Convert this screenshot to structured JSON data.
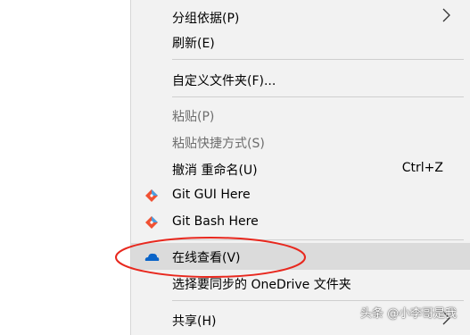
{
  "menu": {
    "items": [
      {
        "label": "分组依据(P)",
        "has_submenu": true
      },
      {
        "label": "刷新(E)"
      },
      {
        "label": "自定义文件夹(F)..."
      },
      {
        "label": "粘贴(P)",
        "disabled": true
      },
      {
        "label": "粘贴快捷方式(S)",
        "disabled": true
      },
      {
        "label": "撤消 重命名(U)",
        "shortcut": "Ctrl+Z"
      },
      {
        "label": "Git GUI Here",
        "icon": "git-icon"
      },
      {
        "label": "Git Bash Here",
        "icon": "git-icon"
      },
      {
        "label": "在线查看(V)",
        "icon": "onedrive-cloud-icon",
        "highlighted": true
      },
      {
        "label": "选择要同步的 OneDrive 文件夹"
      },
      {
        "label": "共享(H)",
        "has_submenu": true
      }
    ]
  },
  "annotation": {
    "color": "#e8281e"
  },
  "watermark": {
    "text": "头条 @小李哥是我"
  },
  "colors": {
    "menu_bg": "#f2f2f2",
    "highlight_bg": "#dbdbdb",
    "git_orange": "#f05133",
    "onedrive_blue": "#0a64c8"
  }
}
